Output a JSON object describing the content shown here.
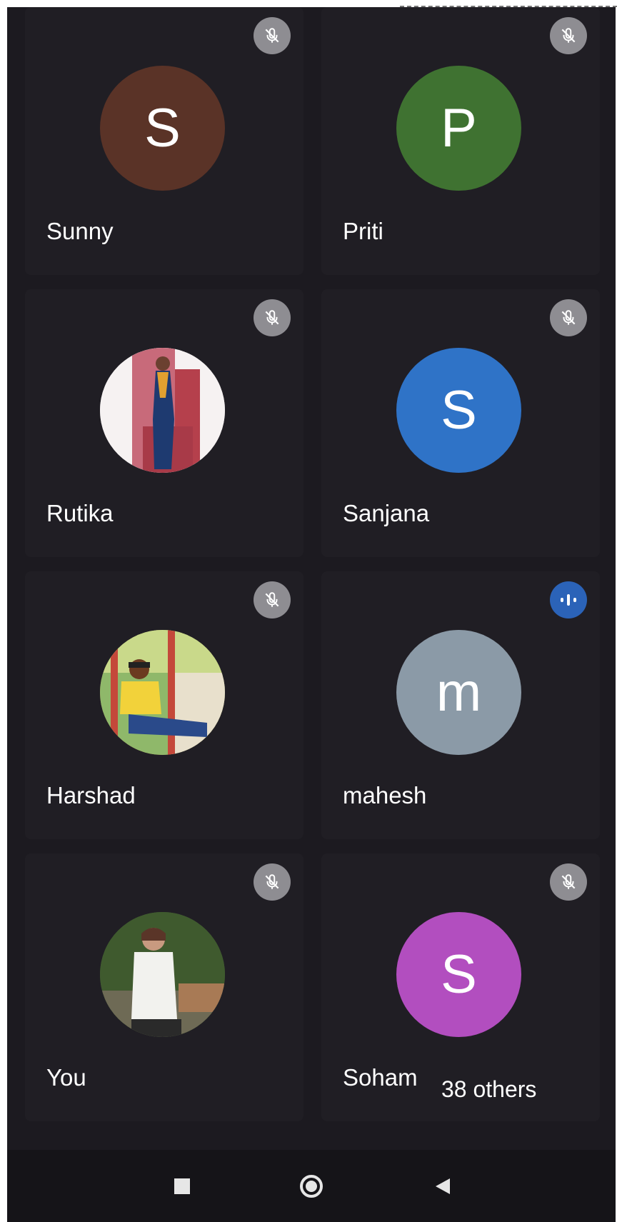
{
  "tiles": [
    {
      "name": "Sunny",
      "initial": "S",
      "avatar_color": "#5a3327",
      "status": "muted"
    },
    {
      "name": "Priti",
      "initial": "P",
      "avatar_color": "#3f7231",
      "status": "muted"
    },
    {
      "name": "Rutika",
      "initial": "",
      "avatar_color": "#f4f4f4",
      "status": "muted",
      "photo": true
    },
    {
      "name": "Sanjana",
      "initial": "S",
      "avatar_color": "#2f73c7",
      "status": "muted"
    },
    {
      "name": "Harshad",
      "initial": "",
      "avatar_color": "#d99a59",
      "status": "muted",
      "photo": true
    },
    {
      "name": "mahesh",
      "initial": "m",
      "avatar_color": "#8b9aa7",
      "status": "speaking"
    },
    {
      "name": "You",
      "initial": "",
      "avatar_color": "#4a6a3b",
      "status": "muted",
      "photo": true
    },
    {
      "name": "Soham",
      "initial": "S",
      "avatar_color": "#b24ebf",
      "status": "muted"
    }
  ],
  "others_label": "38 others",
  "icons": {
    "muted": "mic-off-icon",
    "speaking": "audio-level-icon",
    "nav_recents": "square-icon",
    "nav_home": "circle-home-icon",
    "nav_back": "back-triangle-icon"
  }
}
